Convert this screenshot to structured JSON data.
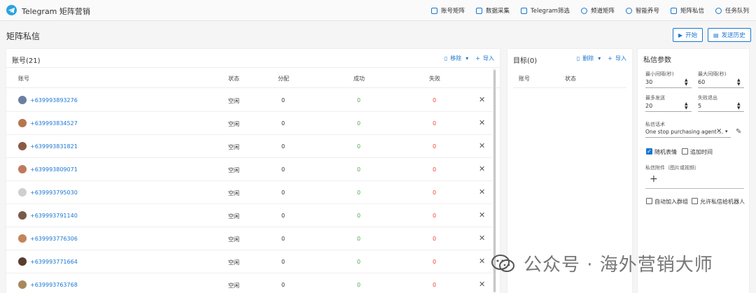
{
  "app": {
    "title": "Telegram 矩阵营销"
  },
  "nav": [
    {
      "label": "账号矩阵",
      "icon": "id-card-icon"
    },
    {
      "label": "数据采集",
      "icon": "data-icon"
    },
    {
      "label": "Telegram筛选",
      "icon": "filter-icon"
    },
    {
      "label": "频道矩阵",
      "icon": "broadcast-icon"
    },
    {
      "label": "智能养号",
      "icon": "binoculars-icon"
    },
    {
      "label": "矩阵私信",
      "icon": "message-icon"
    },
    {
      "label": "任务队列",
      "icon": "queue-icon"
    }
  ],
  "page": {
    "title": "矩阵私信",
    "start_label": "开始",
    "history_label": "发送历史"
  },
  "accounts": {
    "title": "账号(21)",
    "remove_label": "移除",
    "import_label": "导入",
    "columns": [
      "账号",
      "状态",
      "分配",
      "成功",
      "失败"
    ],
    "rows": [
      {
        "phone": "+639993893276",
        "status": "空闲",
        "assigned": "0",
        "success": "0",
        "fail": "0"
      },
      {
        "phone": "+639993834527",
        "status": "空闲",
        "assigned": "0",
        "success": "0",
        "fail": "0"
      },
      {
        "phone": "+639993831821",
        "status": "空闲",
        "assigned": "0",
        "success": "0",
        "fail": "0"
      },
      {
        "phone": "+639993809071",
        "status": "空闲",
        "assigned": "0",
        "success": "0",
        "fail": "0"
      },
      {
        "phone": "+639993795030",
        "status": "空闲",
        "assigned": "0",
        "success": "0",
        "fail": "0"
      },
      {
        "phone": "+639993791140",
        "status": "空闲",
        "assigned": "0",
        "success": "0",
        "fail": "0"
      },
      {
        "phone": "+639993776306",
        "status": "空闲",
        "assigned": "0",
        "success": "0",
        "fail": "0"
      },
      {
        "phone": "+639993771664",
        "status": "空闲",
        "assigned": "0",
        "success": "0",
        "fail": "0"
      },
      {
        "phone": "+639993763768",
        "status": "空闲",
        "assigned": "0",
        "success": "0",
        "fail": "0"
      }
    ],
    "avatar_colors": [
      "#6b7fa0",
      "#b5764f",
      "#8a5a44",
      "#c07a5c",
      "#cfcfcf",
      "#7a5a4a",
      "#c4845c",
      "#5a3d2e",
      "#a8885a"
    ]
  },
  "targets": {
    "title": "目标(0)",
    "delete_label": "删除",
    "import_label": "导入",
    "columns": [
      "账号",
      "状态"
    ]
  },
  "params": {
    "title": "私信参数",
    "min_interval_label": "最小间隔(秒)",
    "min_interval": "30",
    "max_interval_label": "最大间隔(秒)",
    "max_interval": "60",
    "max_send_label": "最多发送",
    "max_send": "20",
    "fail_exit_label": "失败退出",
    "fail_exit": "5",
    "script_label": "私信话术",
    "script_value": "One stop purchasing agent ...",
    "random_emoji_label": "随机表情",
    "random_emoji_checked": true,
    "add_time_label": "追加时间",
    "add_time_checked": false,
    "attachment_label": "私信附件（图片或视频）",
    "auto_join_label": "自动加入群组",
    "allow_bot_label": "允许私信给机器人"
  },
  "watermark": {
    "text": "公众号 · 海外营销大师"
  },
  "colors": {
    "accent": "#1976d2",
    "success": "#4caf50",
    "danger": "#f44336"
  }
}
